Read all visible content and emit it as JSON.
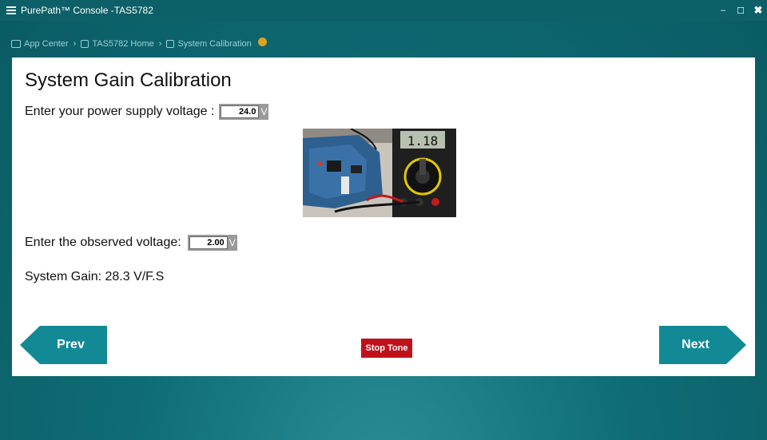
{
  "window": {
    "title": "PurePath™ Console -TAS5782",
    "minimize": "–",
    "maximize": "☐",
    "close": "✖"
  },
  "breadcrumb": {
    "items": [
      {
        "label": "App Center",
        "icon": "app-center-icon"
      },
      {
        "label": "TAS5782 Home",
        "icon": "chip-icon"
      },
      {
        "label": "System Calibration",
        "icon": "chip-icon"
      }
    ],
    "separator": "›"
  },
  "page": {
    "title": "System Gain Calibration",
    "supply_label": "Enter your power supply voltage :",
    "supply_value": "24.0",
    "supply_unit": "V",
    "observed_label": "Enter the observed voltage:",
    "observed_value": "2.00",
    "observed_unit": "V",
    "gain_text": "System Gain: 28.3 V/F.S",
    "multimeter_reading": "1.18"
  },
  "buttons": {
    "prev": "Prev",
    "next": "Next",
    "stop_tone": "Stop Tone"
  },
  "colors": {
    "accent": "#118a96",
    "stop": "#c0111b",
    "titlebar": "#0d5f68"
  }
}
